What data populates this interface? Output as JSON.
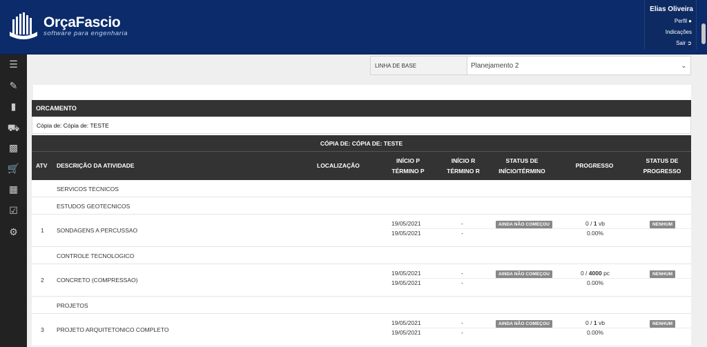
{
  "header": {
    "logo_name": "OrçaFascio",
    "logo_sub": "software para engenharia",
    "user_name": "Elias Oliveira",
    "links": [
      "Perfil",
      "Indicações",
      "Sair"
    ]
  },
  "sidebar": {
    "icons": [
      "list-icon",
      "pencil-icon",
      "eraser-icon",
      "truck-icon",
      "book-icon",
      "cart-icon",
      "calendar-icon",
      "clipboard-icon",
      "gear-icon"
    ]
  },
  "baseline": {
    "label": "LINHA DE BASE",
    "value": "Planejamento 2"
  },
  "orcamento": {
    "header": "ORCAMENTO",
    "name": "Cópia de: Cópia de: TESTE"
  },
  "table": {
    "title": "CÓPIA DE: CÓPIA DE: TESTE",
    "headers": {
      "atv": "ATV",
      "descricao": "DESCRIÇÃO DA ATIVIDADE",
      "localizacao": "LOCALIZAÇÃO",
      "inicio_p": "INÍCIO P",
      "termino_p": "TÉRMINO P",
      "inicio_r": "INÍCIO R",
      "termino_r": "TÉRMINO R",
      "status_1": "STATUS DE",
      "status_2": "INÍCIO/TÉRMINO",
      "progresso": "PROGRESSO",
      "status_prog_1": "STATUS DE",
      "status_prog_2": "PROGRESSO"
    },
    "groups": [
      {
        "label": "SERVICOS TECNICOS"
      },
      {
        "label": "ESTUDOS GEOTECNICOS"
      },
      {
        "label": "CONTROLE TECNOLOGICO"
      },
      {
        "label": "PROJETOS"
      }
    ],
    "activities": [
      {
        "atv": "1",
        "descricao": "SONDAGENS A PERCUSSAO",
        "inicio_p": "19/05/2021",
        "termino_p": "19/05/2021",
        "inicio_r": "-",
        "termino_r": "-",
        "status": "AINDA NÃO COMEÇOU",
        "prog_done": "0",
        "prog_total": "1",
        "prog_unit": "vb",
        "prog_pct": "0.00%",
        "status_prog": "NENHUM"
      },
      {
        "atv": "2",
        "descricao": "CONCRETO (COMPRESSAO)",
        "inicio_p": "19/05/2021",
        "termino_p": "19/05/2021",
        "inicio_r": "-",
        "termino_r": "-",
        "status": "AINDA NÃO COMEÇOU",
        "prog_done": "0",
        "prog_total": "4000",
        "prog_unit": "pc",
        "prog_pct": "0.00%",
        "status_prog": "NENHUM"
      },
      {
        "atv": "3",
        "descricao": "PROJETO ARQUITETONICO COMPLETO",
        "inicio_p": "19/05/2021",
        "termino_p": "19/05/2021",
        "inicio_r": "-",
        "termino_r": "-",
        "status": "AINDA NÃO COMEÇOU",
        "prog_done": "0",
        "prog_total": "1",
        "prog_unit": "vb",
        "prog_pct": "0.00%",
        "status_prog": "NENHUM"
      }
    ]
  },
  "colors": {
    "header_bg": "#0b2b6b",
    "sidebar_bg": "#222222",
    "table_header_bg": "#333333",
    "badge_bg": "#888888"
  }
}
